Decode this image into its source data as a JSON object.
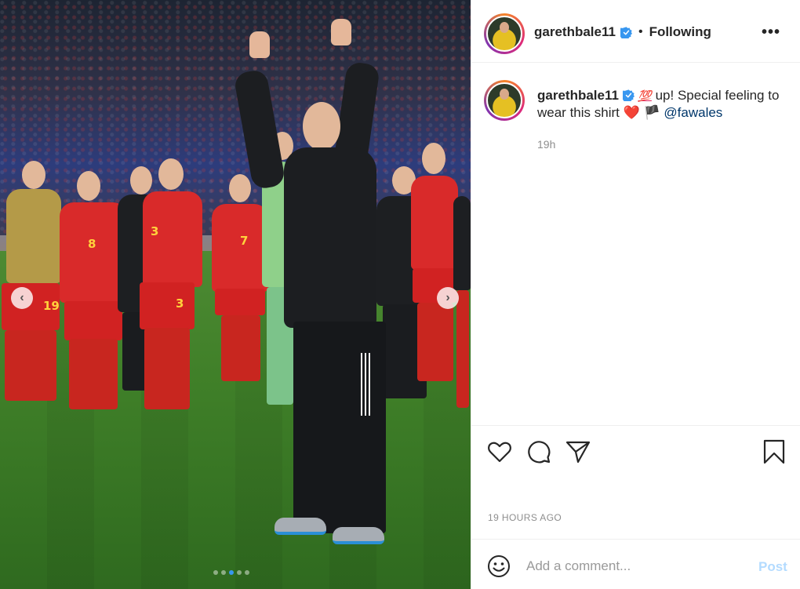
{
  "post": {
    "carousel": {
      "prev_icon": "chevron-left-icon",
      "next_icon": "chevron-right-icon",
      "prev_glyph": "‹",
      "next_glyph": "›",
      "slide_count": 5,
      "active_slide": 3,
      "shirt_numbers": [
        "19",
        "8",
        "3",
        "7",
        "3"
      ]
    },
    "header": {
      "username": "garethbale11",
      "verified_icon": "verified-badge-icon",
      "separator": "•",
      "follow_status": "Following",
      "more_icon": "more-options-icon",
      "more_glyph": "•••"
    },
    "caption": {
      "username": "garethbale11",
      "emoji_100": "💯",
      "text_part1": " up! Special feeling to wear this shirt ",
      "heart": "❤️",
      "flag": "🏴",
      "mention": "@fawales",
      "time": "19h"
    },
    "actions": {
      "like_icon": "heart-outline-icon",
      "comment_icon": "comment-bubble-icon",
      "share_icon": "paper-plane-icon",
      "save_icon": "bookmark-icon"
    },
    "timestamp": "19 HOURS AGO",
    "comment": {
      "emoji_icon": "smiley-face-icon",
      "placeholder": "Add a comment...",
      "value": "",
      "post_label": "Post"
    },
    "colors": {
      "link": "#00376b",
      "verified": "#3897f0",
      "post_disabled": "#b3dbff",
      "muted": "#8e8e8e"
    }
  }
}
